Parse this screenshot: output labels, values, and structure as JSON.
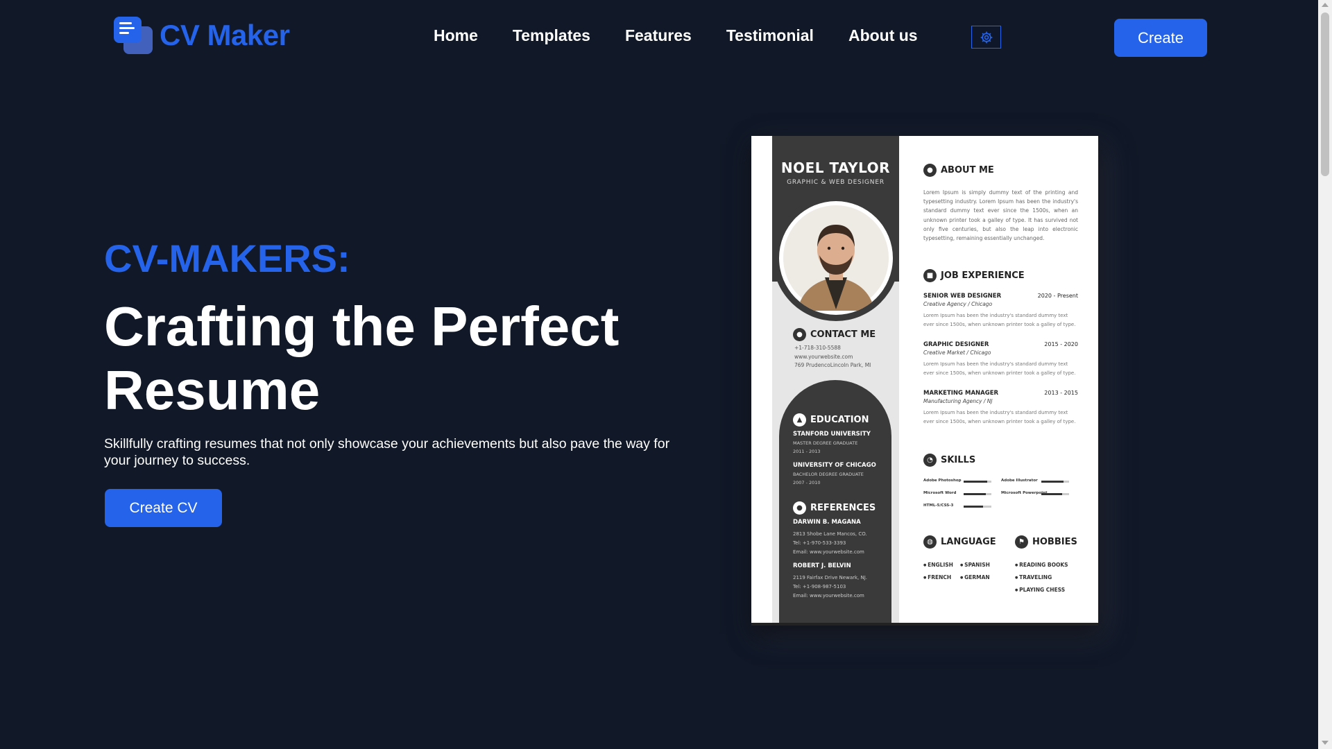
{
  "brand": {
    "name": "CV Maker",
    "color": "#2563eb"
  },
  "nav": {
    "items": [
      "Home",
      "Templates",
      "Features",
      "Testimonial",
      "About us"
    ],
    "theme_icon": "gear-icon",
    "create_label": "Create"
  },
  "hero": {
    "kicker": "CV-MAKERS:",
    "title": "Crafting the Perfect Resume",
    "description": "Skillfully crafting resumes that not only showcase your achievements but also pave the way for your journey to success.",
    "cta_label": "Create CV"
  },
  "resume": {
    "name": "NOEL TAYLOR",
    "role": "GRAPHIC & WEB DESIGNER",
    "contact_title": "CONTACT ME",
    "contact": [
      "+1-718-310-5588",
      "www.yourwebsite.com",
      "769 PrudencoLincoln Park, MI"
    ],
    "education_title": "EDUCATION",
    "education": [
      {
        "school": "STANFORD UNIVERSITY",
        "degree": "MASTER DEGREE GRADUATE",
        "years": "2011 - 2013"
      },
      {
        "school": "UNIVERSITY OF CHICAGO",
        "degree": "BACHELOR DEGREE GRADUATE",
        "years": "2007 - 2010"
      }
    ],
    "references_title": "REFERENCES",
    "references": [
      {
        "name": "DARWIN B. MAGANA",
        "address": "2813 Shobe Lane Mancos, CO.",
        "tel": "Tel: +1-970-533-3393",
        "email": "Email: www.yourwebsite.com"
      },
      {
        "name": "ROBERT J. BELVIN",
        "address": "2119 Fairfax Drive Newark, NJ.",
        "tel": "Tel: +1-908-987-5103",
        "email": "Email: www.yourwebsite.com"
      }
    ],
    "about_title": "ABOUT ME",
    "about_text": "Lorem Ipsum is simply dummy text of the printing and typesetting industry. Lorem Ipsum has been the industry's standard dummy text ever since the 1500s, when an unknown printer took a galley of type. It has survived not only five centuries, but also the leap into electronic typesetting, remaining essentially unchanged.",
    "job_title": "JOB EXPERIENCE",
    "jobs": [
      {
        "title": "SENIOR WEB DESIGNER",
        "date": "2020 - Present",
        "company": "Creative Agency / Chicago",
        "desc": "Lorem Ipsum has been the industry's standard dummy text ever since 1500s, when unknown printer took a galley of type."
      },
      {
        "title": "GRAPHIC DESIGNER",
        "date": "2015 - 2020",
        "company": "Creative Market / Chicago",
        "desc": "Lorem Ipsum has been the industry's standard dummy text ever since 1500s, when unknown printer took a galley of type."
      },
      {
        "title": "MARKETING MANAGER",
        "date": "2013 - 2015",
        "company": "Manufacturing Agency / NJ",
        "desc": "Lorem Ipsum has been the industry's standard dummy text ever since 1500s, when unknown printer took a galley of type."
      }
    ],
    "skills_title": "SKILLS",
    "skills": [
      {
        "name": "Adobe Photoshop",
        "level": 0.85
      },
      {
        "name": "Adobe Illustrator",
        "level": 0.8
      },
      {
        "name": "Microsoft Word",
        "level": 0.8
      },
      {
        "name": "Microsoft Powerpoint",
        "level": 0.75
      },
      {
        "name": "HTML-5/CSS-3",
        "level": 0.7
      }
    ],
    "language_title": "LANGUAGE",
    "languages": [
      "ENGLISH",
      "SPANISH",
      "FRENCH",
      "GERMAN"
    ],
    "hobbies_title": "HOBBIES",
    "hobbies": [
      "READING BOOKS",
      "TRAVELING",
      "PLAYING CHESS"
    ]
  }
}
